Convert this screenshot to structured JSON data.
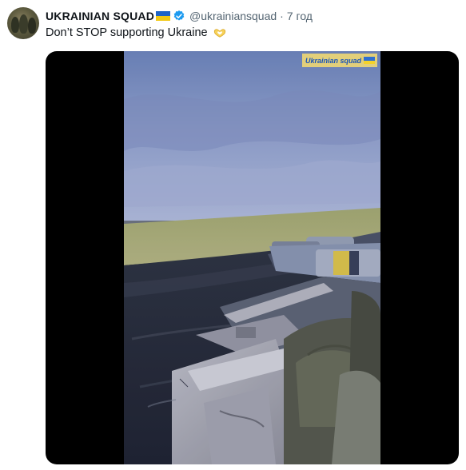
{
  "tweet": {
    "display_name": "UKRAINIAN SQUAD",
    "handle": "@ukrainiansquad",
    "separator": "·",
    "time": "7 год",
    "text": "Don’t STOP supporting Ukraine",
    "verified_icon": "verified-badge-icon",
    "name_flag_icon": "ukraine-flag-icon",
    "text_emoji_icon": "heart-hands-icon"
  },
  "media": {
    "type": "video",
    "watermark_text": "Ukrainian squad",
    "watermark_flag_icon": "ukraine-flag-icon"
  },
  "colors": {
    "text_primary": "#0f1419",
    "text_secondary": "#536471",
    "verified_blue": "#1d9bf0",
    "flag_blue": "#1e63c6",
    "flag_yellow": "#f2c812",
    "media_background": "#000000"
  }
}
